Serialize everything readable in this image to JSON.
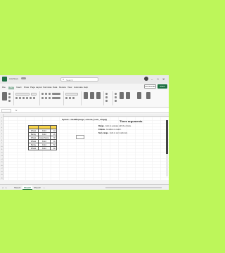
{
  "window": {
    "autosave_label": "AutoSave",
    "search_placeholder": "Search",
    "search_icon": "search-icon",
    "minimize": "–",
    "maximize": "□",
    "close": "✕"
  },
  "menu": {
    "items": [
      "File",
      "Home",
      "Insert",
      "Draw",
      "Page Layout",
      "Formulas",
      "Data",
      "Review",
      "View",
      "Automate",
      "Help"
    ],
    "active_index": 1,
    "comments_label": "Comments",
    "share_label": "Share"
  },
  "formula_bar": {
    "name_box": "",
    "fx_label": "fx"
  },
  "sheet": {
    "syntax": "Syntax: =SUMIF(range, criteria, [sum_range])",
    "table_headers": [
      "",
      "",
      ""
    ],
    "rows": [
      {
        "a": "Wheat",
        "b": "Field",
        "c": "10"
      },
      {
        "a": "Barley",
        "b": "Field",
        "c": "20"
      },
      {
        "a": "Wheat",
        "b": "Greenhouse",
        "c": "30"
      },
      {
        "a": "Wheat",
        "b": "Field",
        "c": "40"
      },
      {
        "a": "Barley",
        "b": "Field",
        "c": "50"
      },
      {
        "a": "Wheat",
        "b": "Field",
        "c": "60"
      }
    ],
    "formula_cell_value": "",
    "row_numbers": [
      "1",
      "2",
      "3",
      "4",
      "5",
      "6",
      "7",
      "8",
      "9",
      "10",
      "11",
      "12",
      "13",
      "14",
      "15",
      "16",
      "17",
      "18",
      "19",
      "20"
    ],
    "header_color": "#f7d44a"
  },
  "arguments": {
    "title": "Three arguments",
    "items": [
      {
        "name": "Range",
        "text": "- Cells to evaluate with the criteria."
      },
      {
        "name": "Criteria",
        "text": "- Condition to match."
      },
      {
        "name": "Sum_range",
        "text": "- Cells to sum (optional)."
      }
    ]
  },
  "sheet_tabs": {
    "tabs": [
      "Sheet1",
      "Sheet2",
      "Sheet3"
    ],
    "active_index": 1,
    "add_label": "+"
  },
  "colors": {
    "background": "#bdf65a",
    "accent": "#1d6f42"
  }
}
